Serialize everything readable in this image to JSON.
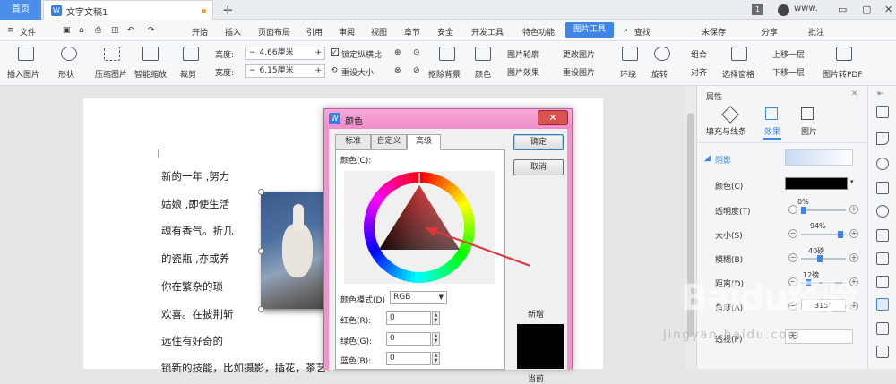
{
  "titlebar": {
    "home_tab": "首页",
    "doc_tab": "文字文稿1",
    "new_tab_symbol": "+",
    "page_badge": "1",
    "user_name": "www."
  },
  "menubar": {
    "file_menu": "文件",
    "items": [
      "开始",
      "插入",
      "页面布局",
      "引用",
      "审阅",
      "视图",
      "章节",
      "安全",
      "开发工具",
      "特色功能",
      "图片工具"
    ],
    "search": "查找",
    "unsaved": "未保存",
    "share": "分享",
    "comment": "批注"
  },
  "ribbon": {
    "insert_image": "插入图片",
    "shape": "形状",
    "compress": "压缩图片",
    "smart_scale": "智能缩放",
    "crop": "裁剪",
    "height_label": "高度:",
    "height_value": "4.66厘米",
    "width_label": "宽度:",
    "width_value": "6.15厘米",
    "lock_ratio": "锁定纵横比",
    "reset_size": "重设大小",
    "remove_bg": "抠除背景",
    "color": "颜色",
    "image_outline": "图片轮廓",
    "image_effect": "图片效果",
    "change_image": "更改图片",
    "reset_image": "重设图片",
    "wrap": "环绕",
    "rotate": "旋转",
    "group": "组合",
    "align": "对齐",
    "selection_pane": "选择窗格",
    "bring_forward": "上移一层",
    "send_backward": "下移一层",
    "to_pdf": "图片转PDF"
  },
  "document": {
    "lines": [
      "新的一年 ,努力",
      "姑娘 ,即使生活",
      "魂有香气。折几",
      "的瓷瓶 ,亦或养",
      "你在繁杂的琐",
      "欢喜。在披荆斩",
      "远住有好奇的",
      "锁新的技能，比如摄影，插花，茶艺"
    ]
  },
  "panel": {
    "title": "属性",
    "tabs": [
      "填充与线条",
      "效果",
      "图片"
    ],
    "section": "阴影",
    "rows": [
      {
        "label": "颜色(C)"
      },
      {
        "label": "透明度(T)",
        "value": "0%",
        "fraction": 0.0
      },
      {
        "label": "大小(S)",
        "value": "94%",
        "fraction": 0.94
      },
      {
        "label": "模糊(B)",
        "value": "40磅",
        "fraction": 0.4
      },
      {
        "label": "距离(D)",
        "value": "12磅",
        "fraction": 0.12
      },
      {
        "label": "角度(A)",
        "value": "315°"
      },
      {
        "label": "透视(P)",
        "value": "无"
      }
    ],
    "colors": {
      "shadow_color": "#000000"
    }
  },
  "dialog": {
    "title": "颜色",
    "close": "✕",
    "tabs": [
      "标准",
      "自定义",
      "高级"
    ],
    "color_label": "颜色(C):",
    "mode_label": "颜色模式(D)",
    "mode_value": "RGB",
    "red_label": "红色(R):",
    "red_value": "0",
    "green_label": "绿色(G):",
    "green_value": "0",
    "blue_label": "蓝色(B):",
    "blue_value": "0",
    "ok": "确定",
    "cancel": "取消",
    "new_label": "新增",
    "current_label": "当前",
    "new_color": "#000000"
  },
  "watermark": {
    "logo": "Baidu经验",
    "url": "jingyan.baidu.com"
  },
  "colors": {
    "accent": "#3f85e6",
    "dialog_frame": "#ef94cc",
    "annotation_arrow": "#e0353b"
  }
}
